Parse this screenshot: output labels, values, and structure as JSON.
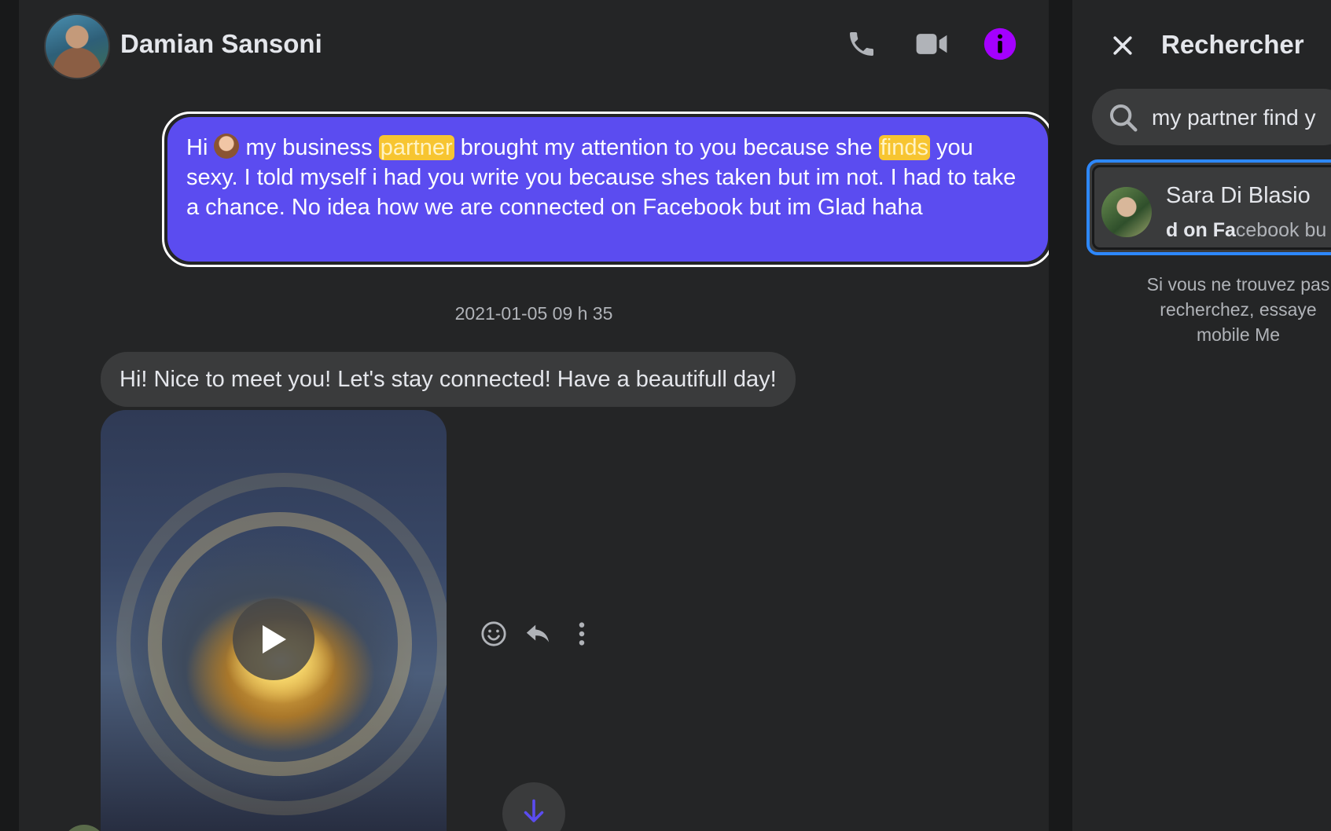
{
  "conversation": {
    "contact_name": "Damian Sansoni",
    "icons": [
      "phone-icon",
      "video-camera-icon",
      "info-icon"
    ],
    "accent_color": "#a400ff"
  },
  "messages": {
    "outgoing": {
      "part1": "Hi ",
      "part2": " my business ",
      "highlight1": "partner",
      "part3": " brought my attention to you because she ",
      "highlight2": "finds",
      "part4": " you sexy. I told myself i had you write you because shes taken but im not. I had to take a chance. No idea how we are connected on Facebook but im Glad haha",
      "bubble_color": "#5b4cf0",
      "highlight_color": "#f7c531"
    },
    "timestamp": "2021-01-05 09 h 35",
    "incoming_text": "Hi! Nice to meet you! Let's stay connected! Have a beautifull day!"
  },
  "search_panel": {
    "title": "Rechercher",
    "query": "my partner find y",
    "result": {
      "name": "Sara Di Blasio",
      "snippet_bold": "d on Fa",
      "snippet_rest": "cebook bu"
    },
    "help_lines": [
      "Si vous ne trouvez pas",
      "recherchez, essaye",
      "mobile Me"
    ]
  }
}
